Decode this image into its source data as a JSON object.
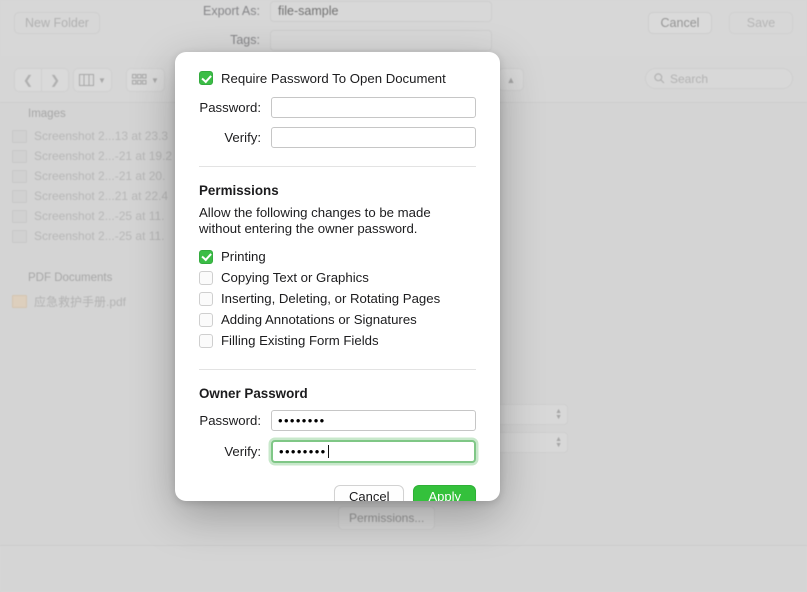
{
  "background": {
    "export_as_label": "Export As:",
    "export_as_value": "file-sample",
    "tags_label": "Tags:",
    "search_placeholder": "Search",
    "nav_back_icon": "chevron-left-icon",
    "nav_forward_icon": "chevron-right-icon",
    "view_columns_icon": "column-view-icon",
    "view_icons_icon": "icon-view-icon",
    "collapse_icon": "chevron-up-icon",
    "search_icon": "search-icon",
    "sidebar": {
      "groups": [
        {
          "header": "Images",
          "items": [
            "Screenshot 2...13 at 23.3",
            "Screenshot 2...-21 at 19.2",
            "Screenshot 2...-21 at 20.",
            "Screenshot 2...21 at 22.4",
            "Screenshot 2...-25 at 11.",
            "Screenshot 2...-25 at 11."
          ]
        },
        {
          "header": "PDF Documents",
          "items": [
            "应急救护手册.pdf"
          ]
        }
      ]
    },
    "permissions_button": "Permissions...",
    "new_folder_button": "New Folder",
    "cancel_button": "Cancel",
    "save_button": "Save"
  },
  "sheet": {
    "require_password": {
      "label": "Require Password To Open Document",
      "checked": true
    },
    "open_password": {
      "password_label": "Password:",
      "password_value": "",
      "verify_label": "Verify:",
      "verify_value": ""
    },
    "permissions": {
      "title": "Permissions",
      "description": "Allow the following changes to be made without entering the owner password.",
      "options": [
        {
          "label": "Printing",
          "checked": true
        },
        {
          "label": "Copying Text or Graphics",
          "checked": false
        },
        {
          "label": "Inserting, Deleting, or Rotating Pages",
          "checked": false
        },
        {
          "label": "Adding Annotations or Signatures",
          "checked": false
        },
        {
          "label": "Filling Existing Form Fields",
          "checked": false
        }
      ]
    },
    "owner_password": {
      "title": "Owner Password",
      "password_label": "Password:",
      "password_value": "••••••••",
      "verify_label": "Verify:",
      "verify_value": "••••••••",
      "verify_focused": true
    },
    "cancel_button": "Cancel",
    "apply_button": "Apply",
    "accent_color": "#34c13c"
  }
}
